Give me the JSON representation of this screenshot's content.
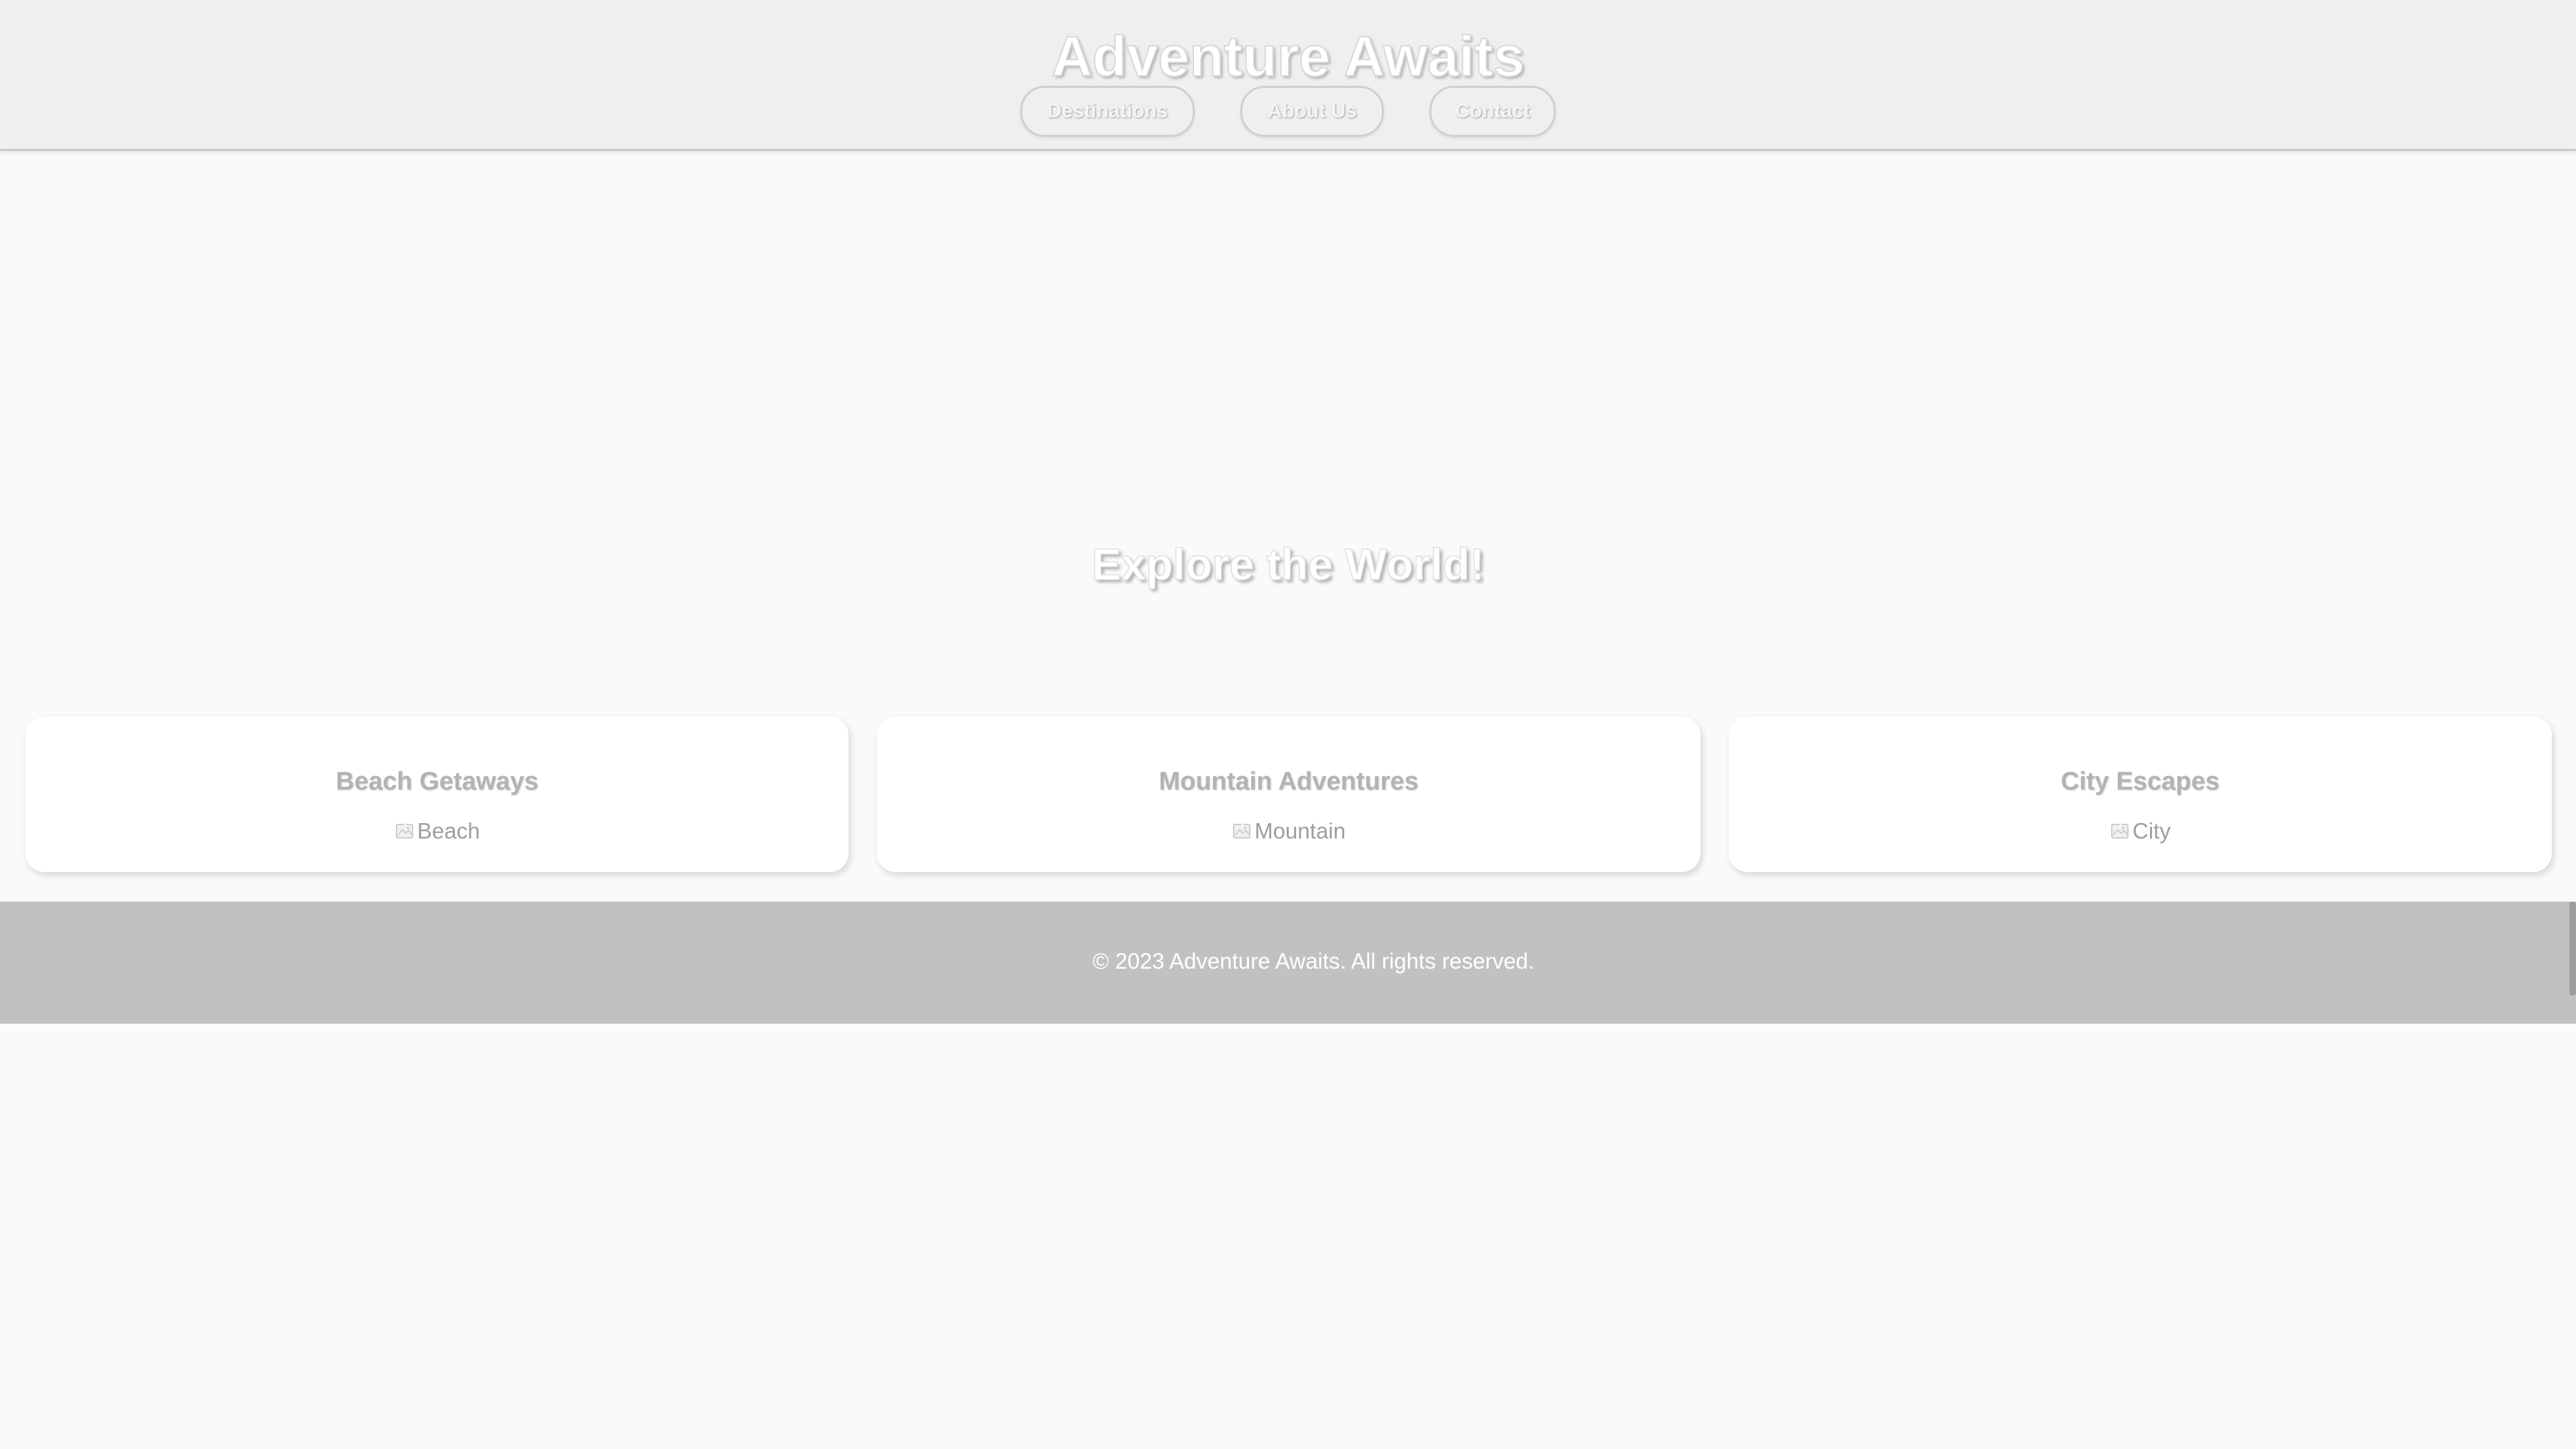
{
  "site": {
    "title": "Adventure Awaits"
  },
  "nav": {
    "items": [
      {
        "label": "Destinations"
      },
      {
        "label": "About Us"
      },
      {
        "label": "Contact"
      }
    ]
  },
  "hero": {
    "title": "Explore the World!"
  },
  "cards": [
    {
      "title": "Beach Getaways",
      "image_alt": "Beach",
      "icon": "broken-image-icon"
    },
    {
      "title": "Mountain Adventures",
      "image_alt": "Mountain",
      "icon": "broken-image-icon"
    },
    {
      "title": "City Escapes",
      "image_alt": "City",
      "icon": "broken-image-icon"
    }
  ],
  "footer": {
    "text": "© 2023 Adventure Awaits. All rights reserved."
  },
  "colors": {
    "header_bg": "#efefef",
    "page_bg": "#fafafa",
    "footer_bg": "#c1c1c1",
    "card_bg": "#ffffff"
  }
}
